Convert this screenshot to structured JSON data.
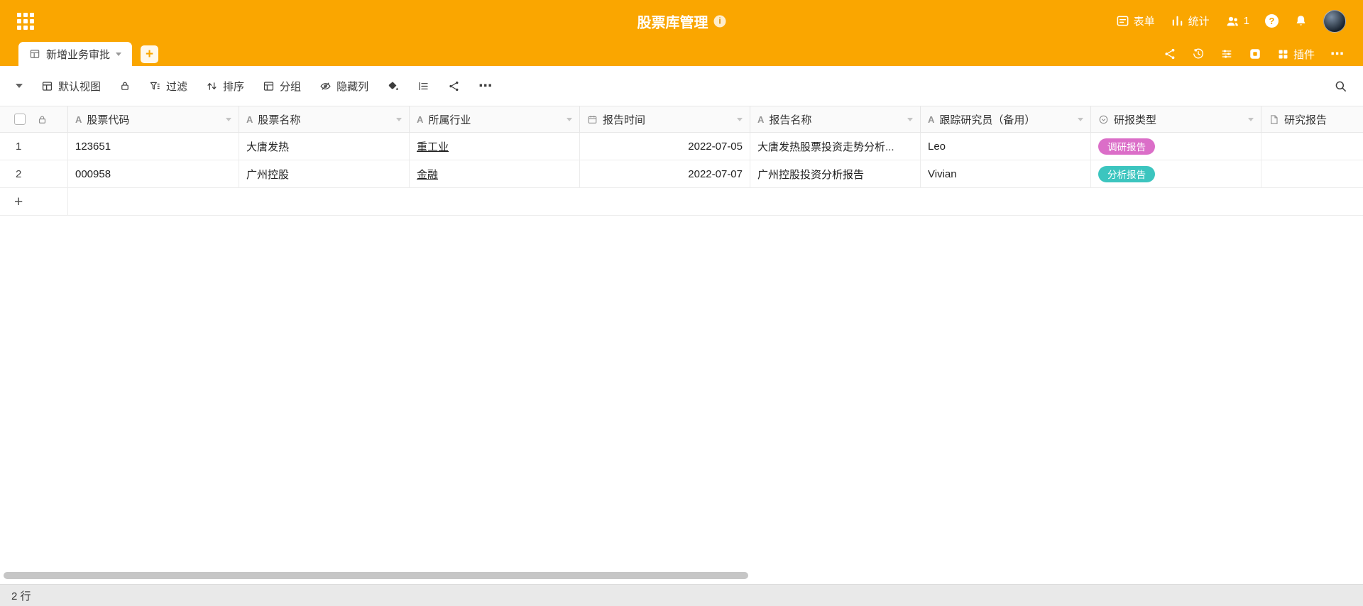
{
  "topbar": {
    "title": "股票库管理",
    "form_label": "表单",
    "stats_label": "统计",
    "collaborator_count": "1"
  },
  "tabbar": {
    "active_tab_label": "新增业务审批",
    "plugins_label": "插件"
  },
  "toolbar": {
    "view_label": "默认视图",
    "filter_label": "过滤",
    "sort_label": "排序",
    "group_label": "分组",
    "hide_columns_label": "隐藏列"
  },
  "icons": {
    "text_column": "A",
    "plus": "+",
    "more": "⋯",
    "info": "i",
    "help": "?"
  },
  "table": {
    "columns": [
      {
        "label": "股票代码",
        "type": "text"
      },
      {
        "label": "股票名称",
        "type": "text"
      },
      {
        "label": "所属行业",
        "type": "text"
      },
      {
        "label": "报告时间",
        "type": "date"
      },
      {
        "label": "报告名称",
        "type": "text"
      },
      {
        "label": "跟踪研究员（备用）",
        "type": "text"
      },
      {
        "label": "研报类型",
        "type": "single_select"
      },
      {
        "label": "研究报告",
        "type": "file"
      }
    ],
    "rows": [
      {
        "index": "1",
        "stock_code": "123651",
        "stock_name": "大唐发热",
        "industry": "重工业",
        "report_date": "2022-07-05",
        "report_name": "大唐发热股票投资走势分析...",
        "researcher": "Leo",
        "report_type": {
          "label": "调研报告",
          "color": "#db6ec8"
        }
      },
      {
        "index": "2",
        "stock_code": "000958",
        "stock_name": "广州控股",
        "industry": "金融",
        "report_date": "2022-07-07",
        "report_name": "广州控股投资分析报告",
        "researcher": "Vivian",
        "report_type": {
          "label": "分析报告",
          "color": "#3cc5bf"
        }
      }
    ]
  },
  "statusbar": {
    "row_count": "2 行"
  },
  "colors": {
    "brand": "#faa600",
    "tag_pink": "#db6ec8",
    "tag_teal": "#3cc5bf"
  }
}
